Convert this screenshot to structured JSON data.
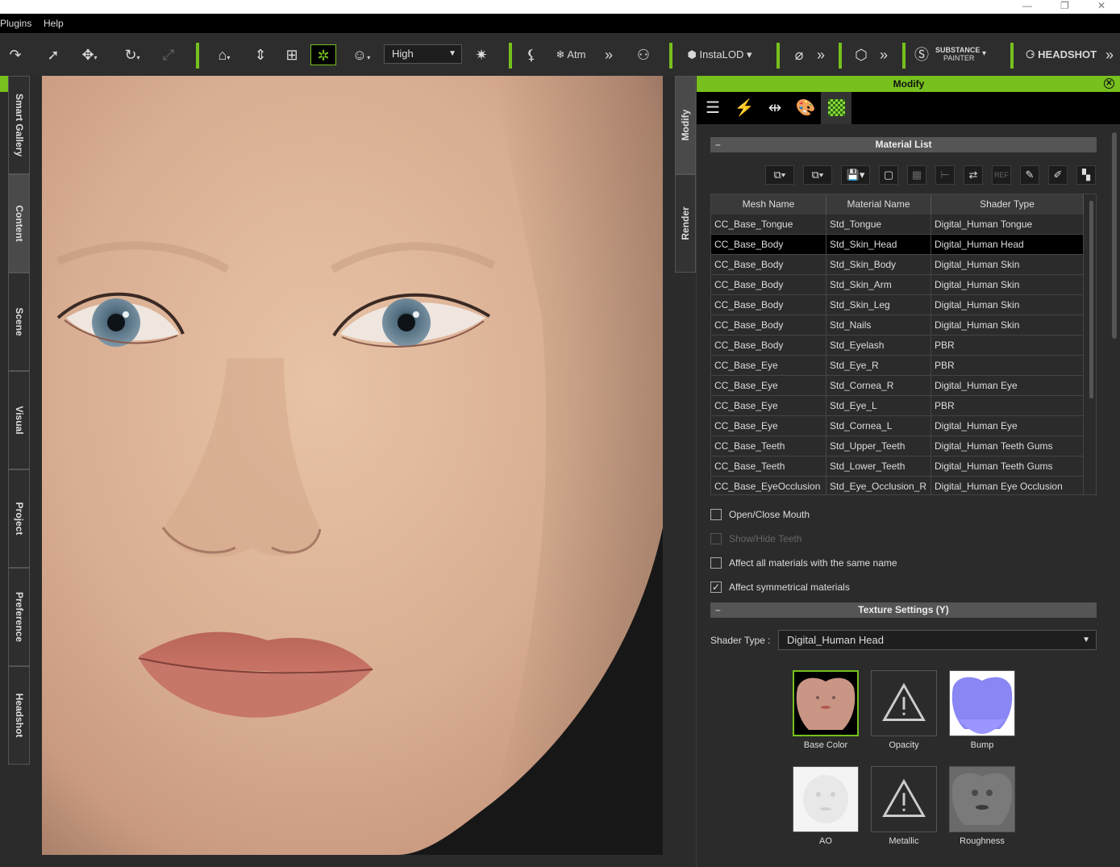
{
  "menu": {
    "plugins": "Plugins",
    "help": "Help"
  },
  "toolbar": {
    "quality_label": "High",
    "atm_label": "Atm",
    "instalod_label": "InstaLOD",
    "substance_label": "SUBSTANCE",
    "substance_sub": "PAINTER",
    "headshot_label": "HEADSHOT"
  },
  "left_tabs": [
    "Smart Gallery",
    "Content",
    "Scene",
    "Visual",
    "Project",
    "Preference",
    "Headshot"
  ],
  "right_tabs": [
    "Modify",
    "Render"
  ],
  "panel": {
    "title": "Modify",
    "material_list_title": "Material List",
    "columns": [
      "Mesh Name",
      "Material Name",
      "Shader Type"
    ],
    "rows": [
      [
        "CC_Base_Tongue",
        "Std_Tongue",
        "Digital_Human Tongue"
      ],
      [
        "CC_Base_Body",
        "Std_Skin_Head",
        "Digital_Human Head"
      ],
      [
        "CC_Base_Body",
        "Std_Skin_Body",
        "Digital_Human Skin"
      ],
      [
        "CC_Base_Body",
        "Std_Skin_Arm",
        "Digital_Human Skin"
      ],
      [
        "CC_Base_Body",
        "Std_Skin_Leg",
        "Digital_Human Skin"
      ],
      [
        "CC_Base_Body",
        "Std_Nails",
        "Digital_Human Skin"
      ],
      [
        "CC_Base_Body",
        "Std_Eyelash",
        "PBR"
      ],
      [
        "CC_Base_Eye",
        "Std_Eye_R",
        "PBR"
      ],
      [
        "CC_Base_Eye",
        "Std_Cornea_R",
        "Digital_Human Eye"
      ],
      [
        "CC_Base_Eye",
        "Std_Eye_L",
        "PBR"
      ],
      [
        "CC_Base_Eye",
        "Std_Cornea_L",
        "Digital_Human Eye"
      ],
      [
        "CC_Base_Teeth",
        "Std_Upper_Teeth",
        "Digital_Human Teeth Gums"
      ],
      [
        "CC_Base_Teeth",
        "Std_Lower_Teeth",
        "Digital_Human Teeth Gums"
      ],
      [
        "CC_Base_EyeOcclusion",
        "Std_Eye_Occlusion_R",
        "Digital_Human Eye Occlusion"
      ]
    ],
    "selected_row": 1,
    "options": {
      "open_close_mouth": "Open/Close Mouth",
      "show_hide_teeth": "Show/Hide Teeth",
      "affect_same_name": "Affect all materials with the same name",
      "affect_symmetrical": "Affect symmetrical materials",
      "affect_symmetrical_checked": true
    },
    "texture_settings_title": "Texture Settings  (Y)",
    "shader_type_label": "Shader Type :",
    "shader_type_value": "Digital_Human Head",
    "textures": [
      "Base Color",
      "Opacity",
      "Bump",
      "AO",
      "Metallic",
      "Roughness"
    ]
  },
  "colors": {
    "accent": "#77c01e",
    "panel_bg": "#2b2b2b",
    "selected_row": "#000000"
  }
}
